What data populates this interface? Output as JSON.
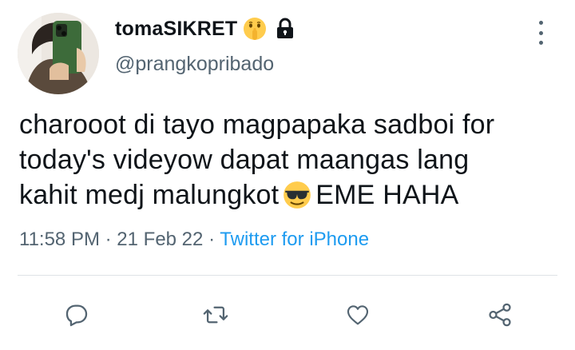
{
  "author": {
    "display_name": "tomaSIKRET",
    "handle": "@prangkopribado",
    "avatar_icon": "avatar-photo",
    "badges": [
      "shushing-face-emoji",
      "lock-icon"
    ]
  },
  "tweet": {
    "lines": [
      "charooot di tayo magpapaka sadboi for",
      "today's videyow dapat maangas lang"
    ],
    "line3_before_emoji": "kahit medj malungkot",
    "inline_emoji": "sunglasses-face-emoji",
    "line3_after_emoji": "EME HAHA"
  },
  "meta": {
    "time": "11:58 PM",
    "separator1": "·",
    "date": "21 Feb 22",
    "separator2": "·",
    "source": "Twitter for iPhone"
  },
  "actions": [
    "reply-icon",
    "retweet-icon",
    "like-icon",
    "share-icon"
  ],
  "colors": {
    "text_primary": "#0f1419",
    "text_secondary": "#536471",
    "link": "#1d9bf0",
    "divider": "#dfe3e6"
  }
}
